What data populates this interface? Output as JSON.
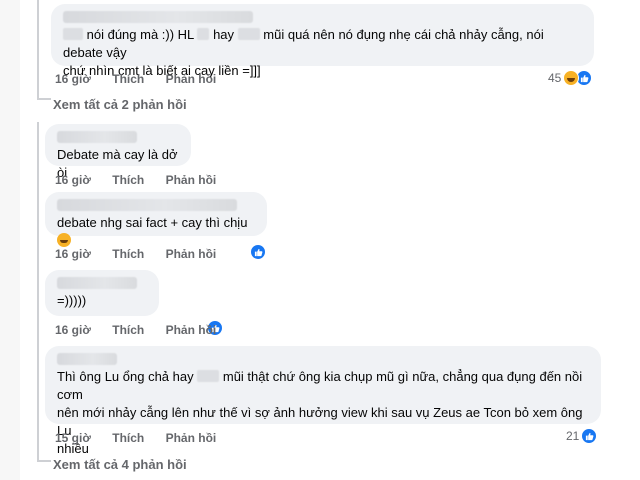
{
  "comments": [
    {
      "text_a": "nói đúng mà :)) HL",
      "text_b": "hay",
      "text_c": "mũi quá nên nó đụng nhẹ cái chả nhảy cẫng, nói debate vậy",
      "line2": "chứ nhìn cmt là biết ai cay liền =]]]",
      "time": "16 giờ",
      "reaction_count": "45",
      "reaction_type": "haha-like"
    },
    {
      "text": "Debate mà cay là dở òi",
      "time": "16 giờ"
    },
    {
      "text": "debate nhg sai fact + cay thì chịu",
      "time": "16 giờ",
      "reaction_type": "like"
    },
    {
      "text": "=)))))",
      "time": "16 giờ",
      "reaction_type": "like"
    },
    {
      "text_a": "Thì ông Lu ổng chả hay",
      "text_b": "mũi thật chứ ông kia chụp mũ gì nữa, chẳng qua đụng đến nồi cơm",
      "line2": "nên mới nhảy cẫng lên như thế vì sợ ảnh hưởng view khi sau vụ Zeus ae Tcon bỏ xem ông Lu",
      "line3": "nhiều",
      "time": "15 giờ",
      "reaction_count": "21",
      "reaction_type": "like"
    }
  ],
  "actions": {
    "like": "Thích",
    "reply": "Phản hồi"
  },
  "view_replies_1": "Xem tất cả 2 phản hồi",
  "view_replies_2": "Xem tất cả 4 phản hồi",
  "colors": {
    "bubble": "#f0f2f5",
    "meta": "#65676b",
    "like_blue": "#1877f2",
    "haha": "#f7b125"
  }
}
